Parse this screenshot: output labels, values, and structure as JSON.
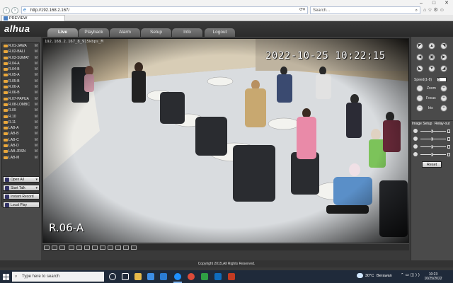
{
  "browser": {
    "url": "http://192.168.2.167/",
    "search_placeholder": "Search...",
    "tab_title": "PREVIEW",
    "window_controls": [
      "–",
      "□",
      "✕"
    ],
    "right_icons": "⌂☆⚙☺"
  },
  "app": {
    "logo": "alhua",
    "tabs": [
      "Live",
      "Playback",
      "Alarm",
      "Setup",
      "Info",
      "Logout"
    ],
    "active_tab": "Live"
  },
  "sidebar": {
    "cameras": [
      {
        "label": "R.01-JAWA",
        "m": "M"
      },
      {
        "label": "R.02-BALI",
        "m": "M"
      },
      {
        "label": "R.03-SUMAT",
        "m": "M"
      },
      {
        "label": "R.04-A",
        "m": "M"
      },
      {
        "label": "R.04-B",
        "m": "M"
      },
      {
        "label": "R.05-A",
        "m": "M"
      },
      {
        "label": "R.05-B",
        "m": "M"
      },
      {
        "label": "R.06-A",
        "m": "M"
      },
      {
        "label": "R.06-B",
        "m": "M"
      },
      {
        "label": "R.07-PAPUA",
        "m": "M"
      },
      {
        "label": "R.08-LOMBC",
        "m": "M"
      },
      {
        "label": "R.09",
        "m": "M"
      },
      {
        "label": "R.10",
        "m": "M"
      },
      {
        "label": "R.11",
        "m": "M"
      },
      {
        "label": "LAB-A",
        "m": "M"
      },
      {
        "label": "LAB-B",
        "m": "M"
      },
      {
        "label": "LAB-C",
        "m": "M"
      },
      {
        "label": "LAB-D",
        "m": "M"
      },
      {
        "label": "LAB-JRSN",
        "m": "M"
      },
      {
        "label": "LAB-M",
        "m": "M"
      }
    ],
    "buttons": {
      "open_all": "Open All",
      "start_talk": "Start Talk",
      "instant_record": "Instant Record",
      "local_play": "Local Play"
    }
  },
  "video": {
    "osd_top": "192.168.2.167_8_915kbps_M",
    "timestamp": "2022-10-25 10:22:15",
    "channel_name": "R.06-A"
  },
  "ptz": {
    "speed_label": "Speed(1-8)",
    "speed_value": "5",
    "zoom_label": "Zoom",
    "focus_label": "Focus",
    "iris_label": "Iris",
    "image_setup_label": "Image Setup",
    "relay_out_label": "Relay-out",
    "reset_label": "Reset"
  },
  "footer": {
    "copyright": "Copyright 2015,All Rights Reserved."
  },
  "taskbar": {
    "search_placeholder": "Type here to search",
    "temperature": "30°C",
    "weather": "Berawan",
    "time": "10:23",
    "date": "10/25/2022",
    "colors": {
      "accent": "#7fb6f0",
      "taskbar": "#1f2a3a"
    }
  },
  "colors": {
    "folder": "#e9a73b",
    "panel": "#4a4a4a",
    "header": "#2b2b2b"
  }
}
